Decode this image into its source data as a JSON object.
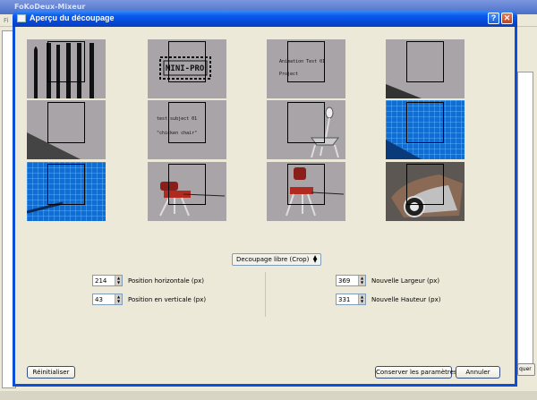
{
  "background_app": {
    "title": "FoKoDeux-Mixeur",
    "menu_first": "Fi",
    "side_button": "quer"
  },
  "dialog": {
    "title": "Aperçu du découpage",
    "help_glyph": "?",
    "close_glyph": "✕"
  },
  "thumbnails": [
    {
      "name": "frame-1",
      "labels": []
    },
    {
      "name": "frame-2",
      "labels": [
        "MINI-PRO"
      ]
    },
    {
      "name": "frame-3",
      "labels": [
        "Animation Test 01",
        "Project"
      ]
    },
    {
      "name": "frame-4",
      "labels": []
    },
    {
      "name": "frame-5",
      "labels": []
    },
    {
      "name": "frame-6",
      "labels": [
        "test subject 01",
        "\"chicken  chair\""
      ]
    },
    {
      "name": "frame-7",
      "labels": []
    },
    {
      "name": "frame-8",
      "labels": []
    },
    {
      "name": "frame-9",
      "labels": []
    },
    {
      "name": "frame-10",
      "labels": []
    },
    {
      "name": "frame-11",
      "labels": []
    },
    {
      "name": "frame-12",
      "labels": []
    }
  ],
  "crop_mode": {
    "selected": "Decoupage libre (Crop)"
  },
  "fields": {
    "pos_x": {
      "value": "214",
      "label": "Position horizontale (px)"
    },
    "pos_y": {
      "value": "43",
      "label": "Position en verticale (px)"
    },
    "width": {
      "value": "369",
      "label": "Nouvelle Largeur (px)"
    },
    "height": {
      "value": "331",
      "label": "Nouvelle Hauteur (px)"
    }
  },
  "buttons": {
    "reset": "Réinitialiser",
    "keep": "Conserver les paramètres",
    "cancel": "Annuler"
  },
  "colors": {
    "dialog_frame": "#0b4fd8",
    "dialog_body": "#ece9d8",
    "thumb_gray": "#a8a4a8",
    "thumb_blue": "#0f6dd4"
  }
}
